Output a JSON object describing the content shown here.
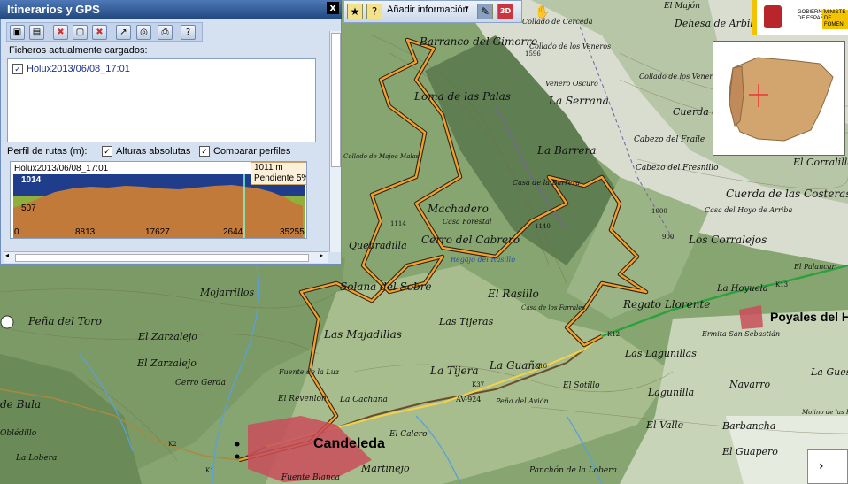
{
  "panel": {
    "title": "Itinerarios y GPS",
    "close_label": "x",
    "files_label": "Ficheros actualmente cargados:",
    "files": [
      {
        "name": "Holux2013/06/08_17:01",
        "checked": "✓"
      }
    ],
    "profile_label": "Perfil de rutas (m):",
    "absolute_heights_label": "Alturas absolutas",
    "compare_profiles_label": "Comparar perfiles"
  },
  "profile_chart": {
    "title": "Holux2013/06/08_17:01",
    "tooltip_altitude": "1011 m",
    "tooltip_slope": "Pendiente 5%",
    "y_ticks": [
      "1014",
      "507",
      "0"
    ],
    "x_ticks": [
      "8813",
      "17627",
      "2644",
      "35255"
    ]
  },
  "toolbar": {
    "add_info_label": "Añadir información",
    "add_info_chevron": "▾"
  },
  "map": {
    "labels": [
      "Barranco del Gimorro",
      "Loma de las Palas",
      "Machadero",
      "Casa Forestal",
      "Cerro del Cabrero",
      "Quebradilla",
      "Solana del Sobre",
      "El Rasillo",
      "Las Tijeras",
      "La Tijera",
      "La Guaña",
      "Las Majadillas",
      "Mojarrillos",
      "Peña del Toro",
      "El Zarzalejo",
      "Cerro Gerda",
      "Fuente de la Luz",
      "El Revenlon",
      "La Cachana",
      "El Calero",
      "Peña del Avión",
      "Martinejo",
      "Fuente Blanca",
      "La Lobera",
      "de Bula",
      "Oblédillo",
      "La Serrana",
      "La Barrera",
      "Casa de la Barrera",
      "Cuerda del Fraile",
      "Cabezo del Fraile",
      "Cabezo del Fresnillo",
      "Collado de los Venero",
      "El Corralillo",
      "Cuerda de las Costeras",
      "Casa del Hoyo de Arriba",
      "Los Corralejos",
      "El Palancar",
      "La Hoyuela",
      "Regato Llorente",
      "Casa de los Farrales",
      "Las Lagunillas",
      "Lagunilla",
      "Navarro",
      "La Guesta",
      "Barbancha",
      "El Valle",
      "El Guapero",
      "El Sotillo",
      "Panchón de la Lobera",
      "El Majón",
      "Dehesa de Arbillas",
      "Collado de Cerceda",
      "Collado de los Veneros",
      "Venero Oscuro",
      "Cuerda del Canchón",
      "Ermita San Sebastián",
      "Molino de las Hiruelas",
      "Collado de Majea Malas",
      "Regajo del Rasillo",
      "AV-924",
      "K37",
      "K16",
      "K13",
      "K12",
      "K1",
      "K2",
      "1596",
      "1140",
      "1114",
      "1000",
      "900",
      "1600",
      "1000"
    ],
    "towns": {
      "candeleda": "Candeleda",
      "poyales": "Poyales del Ho"
    }
  },
  "ministry": {
    "line1": "GOBIERNO",
    "line2": "DE ESPAÑA",
    "line3": "MINISTE",
    "line4": "DE FOMEN"
  },
  "nav": {
    "arrow": "›"
  },
  "colors": {
    "route": "#f0a030",
    "title_bar": "#2e5a96",
    "profile_fill": "#c17a3a",
    "profile_sky": "#1f3d8a"
  }
}
